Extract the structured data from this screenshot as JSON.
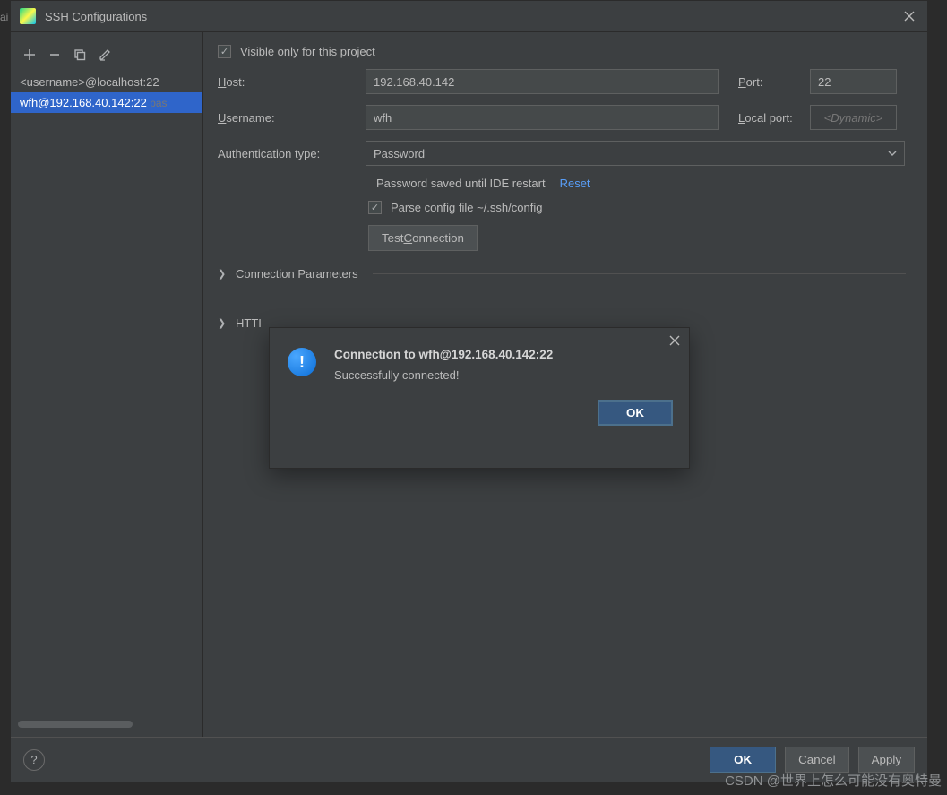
{
  "window": {
    "title": "SSH Configurations"
  },
  "sidebar": {
    "items": [
      {
        "label": "<username>@localhost:22",
        "post": ""
      },
      {
        "label": "wfh@192.168.40.142:22",
        "post": " pas"
      }
    ]
  },
  "form": {
    "visible_only_label": "Visible only for this project",
    "host_label": "Host:",
    "host_value": "192.168.40.142",
    "port_label": "Port:",
    "port_value": "22",
    "username_label": "Username:",
    "username_value": "wfh",
    "localport_label": "Local port:",
    "localport_placeholder": "<Dynamic>",
    "auth_label": "Authentication type:",
    "auth_value": "Password",
    "pw_status": "Password saved until IDE restart",
    "reset_label": "Reset",
    "parse_label": "Parse config file ~/.ssh/config",
    "test_label": "Test Connection",
    "section_conn": "Connection Parameters",
    "section_http": "HTTP"
  },
  "footer": {
    "ok": "OK",
    "cancel": "Cancel",
    "apply": "Apply"
  },
  "dialog": {
    "title": "Connection to wfh@192.168.40.142:22",
    "message": "Successfully connected!",
    "ok": "OK"
  },
  "watermark": "CSDN @世界上怎么可能没有奥特曼",
  "edge": "ai"
}
